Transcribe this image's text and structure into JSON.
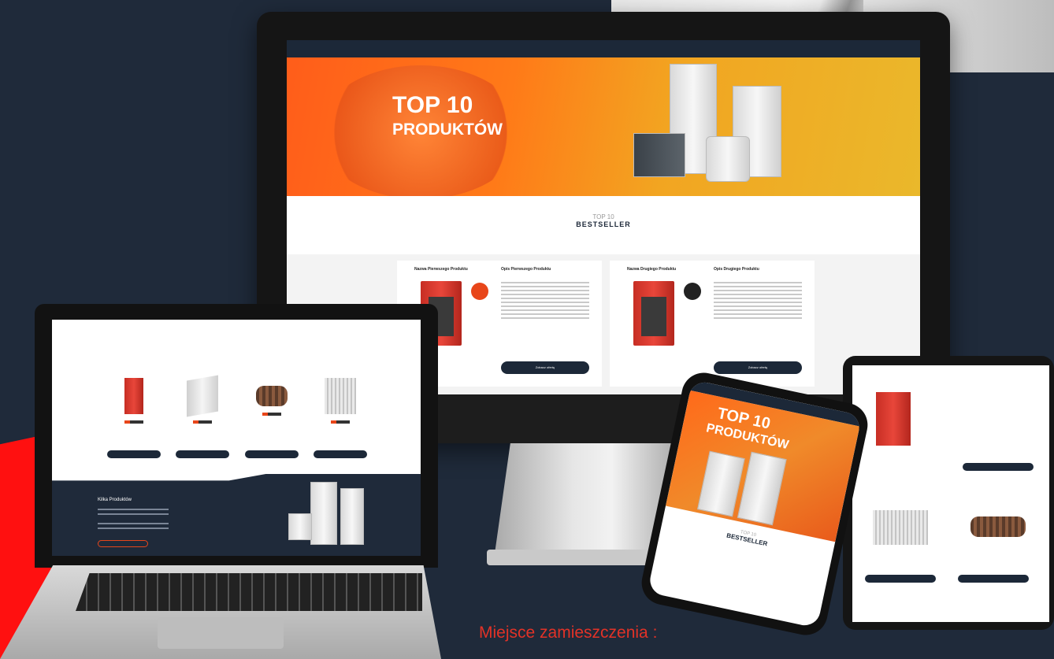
{
  "caption": "Miejsce zamieszczenia :",
  "monitor": {
    "hero_title_line1": "TOP 10",
    "hero_title_line2": "PRODUKTÓW",
    "section_small": "TOP 10",
    "section_big": "BESTSELLER",
    "cards": [
      {
        "name": "Nazwa Pierwszego Produktu",
        "desc_title": "Opis Pierwszego Produktu",
        "button": "Zobacz ofertę"
      },
      {
        "name": "Nazwa Drugiego Produktu",
        "desc_title": "Opis Drugiego Produktu",
        "button": "Zobacz ofertę"
      }
    ]
  },
  "laptop": {
    "band_heading": "Kilka Produktów"
  },
  "phone": {
    "hero_title_line1": "TOP 10",
    "hero_title_line2": "PRODUKTÓW",
    "section_small": "TOP 10",
    "section_big": "BESTSELLER"
  },
  "colors": {
    "background": "#1f2a3a",
    "accent_orange": "#ff6a1a",
    "navy": "#1c2838",
    "caption_red": "#e23227"
  }
}
